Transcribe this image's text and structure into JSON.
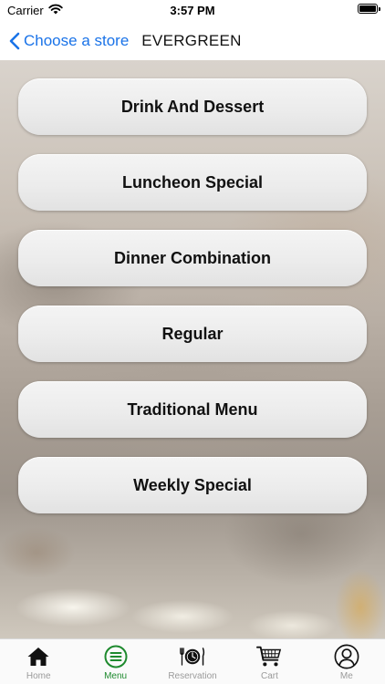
{
  "status_bar": {
    "carrier": "Carrier",
    "time": "3:57 PM"
  },
  "nav": {
    "back_label": "Choose a store",
    "store_name": "EVERGREEN"
  },
  "menu": {
    "items": [
      {
        "label": "Drink And Dessert"
      },
      {
        "label": "Luncheon Special"
      },
      {
        "label": "Dinner Combination"
      },
      {
        "label": "Regular"
      },
      {
        "label": "Traditional Menu"
      },
      {
        "label": "Weekly Special"
      }
    ]
  },
  "tab_bar": {
    "active": "Menu",
    "active_color": "#1e8a2e",
    "inactive_color": "#9a9a9a",
    "tabs": [
      {
        "label": "Home",
        "icon": "home-icon"
      },
      {
        "label": "Menu",
        "icon": "menu-icon"
      },
      {
        "label": "Reservation",
        "icon": "reservation-icon"
      },
      {
        "label": "Cart",
        "icon": "cart-icon"
      },
      {
        "label": "Me",
        "icon": "profile-icon"
      }
    ]
  },
  "colors": {
    "link_blue": "#1a73e8"
  }
}
